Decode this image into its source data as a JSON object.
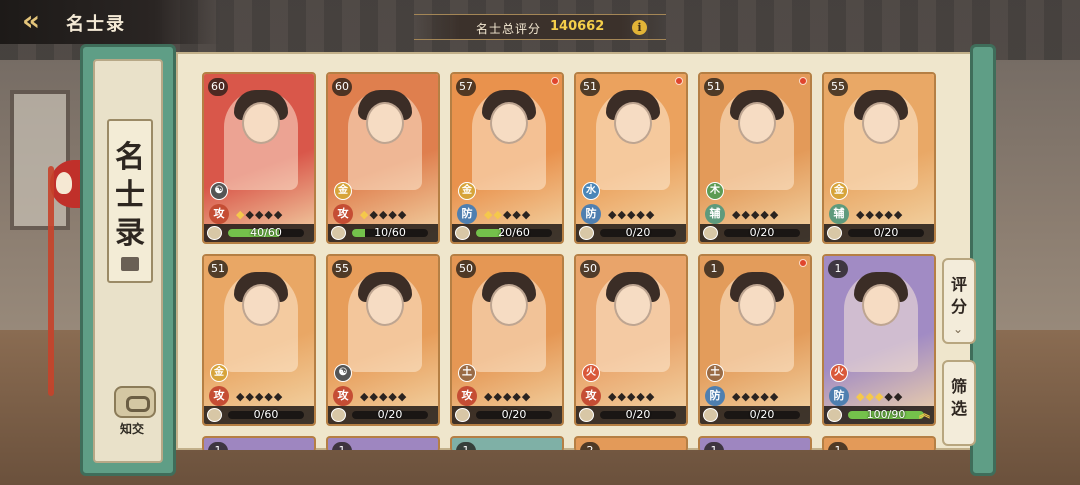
{
  "header": {
    "back_icon": "chevron-left-icon",
    "title": "名士录"
  },
  "score": {
    "label": "名士总评分",
    "value": "140662",
    "info_icon": "i"
  },
  "sidebar": {
    "tag_text": "名士录",
    "zhijiao_label": "知交"
  },
  "buttons": {
    "rating_label": "评分",
    "filter_label": "筛选"
  },
  "colors": {
    "progress": "#74c14b",
    "star_lit": "#f5c84b",
    "accent_gold": "#f5cf4a"
  },
  "cards": [
    {
      "level": "60",
      "element": "☯",
      "role": "攻",
      "role_type": "atk",
      "stars_lit": 1,
      "stars_total": 5,
      "progress_text": "40/60",
      "progress": 0.667,
      "bg": "#d9574a",
      "red_dot": false
    },
    {
      "level": "60",
      "element": "金",
      "role": "攻",
      "role_type": "atk",
      "stars_lit": 1,
      "stars_total": 5,
      "progress_text": "10/60",
      "progress": 0.167,
      "bg": "#df7f4e",
      "red_dot": false
    },
    {
      "level": "57",
      "element": "金",
      "role": "防",
      "role_type": "def",
      "stars_lit": 2,
      "stars_total": 5,
      "progress_text": "20/60",
      "progress": 0.333,
      "bg": "#e9924d",
      "red_dot": true
    },
    {
      "level": "51",
      "element": "水",
      "role": "防",
      "role_type": "def",
      "stars_lit": 0,
      "stars_total": 5,
      "progress_text": "0/20",
      "progress": 0,
      "bg": "#eba25e",
      "red_dot": true
    },
    {
      "level": "51",
      "element": "木",
      "role": "辅",
      "role_type": "sup",
      "stars_lit": 0,
      "stars_total": 5,
      "progress_text": "0/20",
      "progress": 0,
      "bg": "#e39a59",
      "red_dot": true
    },
    {
      "level": "55",
      "element": "金",
      "role": "辅",
      "role_type": "sup",
      "stars_lit": 0,
      "stars_total": 5,
      "progress_text": "0/20",
      "progress": 0,
      "bg": "#e9a866",
      "red_dot": false
    },
    {
      "level": "51",
      "element": "金",
      "role": "攻",
      "role_type": "atk",
      "stars_lit": 0,
      "stars_total": 5,
      "progress_text": "0/60",
      "progress": 0,
      "bg": "#e9a765",
      "red_dot": false
    },
    {
      "level": "55",
      "element": "☯",
      "role": "攻",
      "role_type": "atk",
      "stars_lit": 0,
      "stars_total": 5,
      "progress_text": "0/20",
      "progress": 0,
      "bg": "#e79d5a",
      "red_dot": false
    },
    {
      "level": "50",
      "element": "土",
      "role": "攻",
      "role_type": "atk",
      "stars_lit": 0,
      "stars_total": 5,
      "progress_text": "0/20",
      "progress": 0,
      "bg": "#e59754",
      "red_dot": false
    },
    {
      "level": "50",
      "element": "火",
      "role": "攻",
      "role_type": "atk",
      "stars_lit": 0,
      "stars_total": 5,
      "progress_text": "0/20",
      "progress": 0,
      "bg": "#e9a46a",
      "red_dot": false
    },
    {
      "level": "1",
      "element": "土",
      "role": "防",
      "role_type": "def",
      "stars_lit": 0,
      "stars_total": 5,
      "progress_text": "0/20",
      "progress": 0,
      "bg": "#e39c5b",
      "red_dot": true
    },
    {
      "level": "1",
      "element": "火",
      "role": "防",
      "role_type": "def",
      "stars_lit": 3,
      "stars_total": 5,
      "progress_text": "100/90",
      "progress": 1,
      "bg": "#a18bc4",
      "red_dot": false,
      "upgrade": true
    }
  ],
  "peek_cards": [
    {
      "level": "1",
      "bg": "#9e86c0"
    },
    {
      "level": "1",
      "bg": "#9e86c0"
    },
    {
      "level": "1",
      "bg": "#7fb0a6"
    },
    {
      "level": "2",
      "bg": "#e39a59"
    },
    {
      "level": "1",
      "bg": "#9e86c0"
    },
    {
      "level": "1",
      "bg": "#e39a59"
    }
  ]
}
